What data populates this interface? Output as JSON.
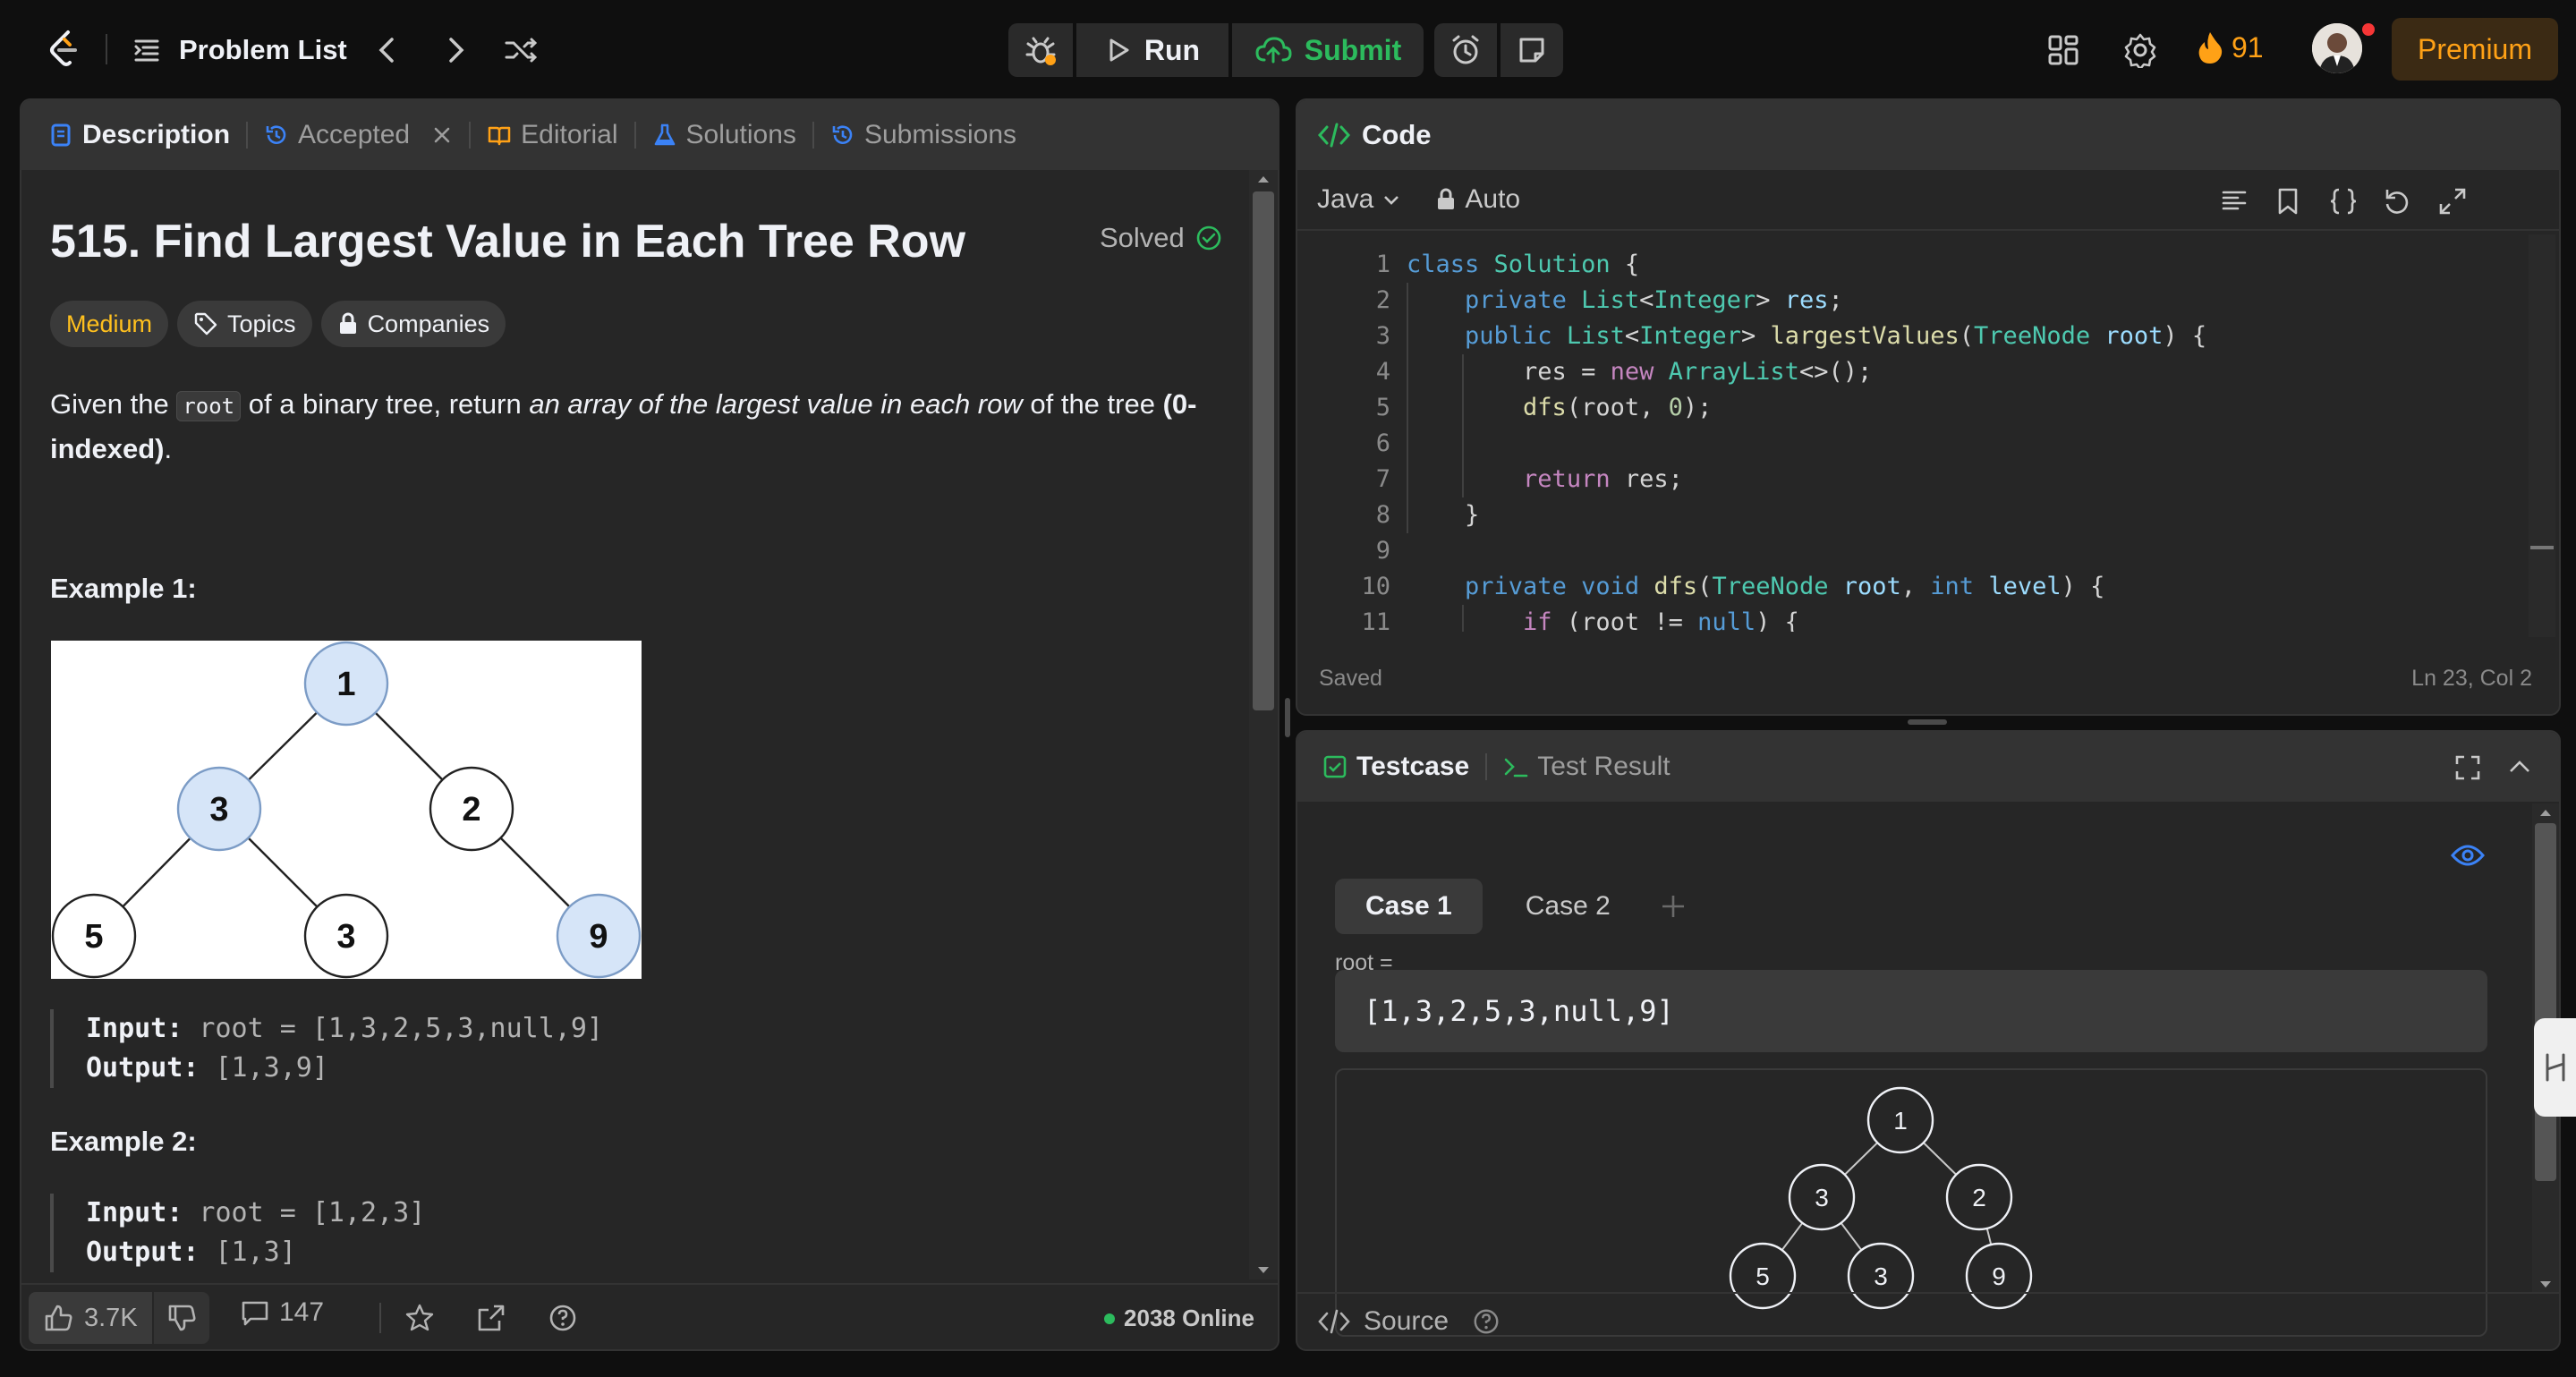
{
  "topbar": {
    "problem_list_label": "Problem List",
    "run_label": "Run",
    "submit_label": "Submit",
    "streak_count": "91",
    "premium_label": "Premium"
  },
  "left_panel": {
    "tabs": [
      {
        "label": "Description",
        "icon": "description-icon"
      },
      {
        "label": "Accepted",
        "icon": "history-icon"
      },
      {
        "label": "Editorial",
        "icon": "book-icon"
      },
      {
        "label": "Solutions",
        "icon": "flask-icon"
      },
      {
        "label": "Submissions",
        "icon": "history-icon"
      }
    ],
    "title": "515. Find Largest Value in Each Tree Row",
    "solved_label": "Solved",
    "chips": {
      "difficulty": "Medium",
      "topics": "Topics",
      "companies": "Companies"
    },
    "statement": {
      "p1": "Given the ",
      "code": "root",
      "p2": " of a binary tree, return ",
      "em": "an array of the largest value in each row",
      "p3": " of the tree ",
      "strong": "(0-indexed)",
      "p4": "."
    },
    "example1": {
      "heading": "Example 1:",
      "input_label": "Input:",
      "input_value": " root = [1,3,2,5,3,null,9]",
      "output_label": "Output:",
      "output_value": " [1,3,9]",
      "tree_nodes": [
        "1",
        "3",
        "2",
        "5",
        "3",
        "9"
      ]
    },
    "example2": {
      "heading": "Example 2:",
      "input_label": "Input:",
      "input_value": " root = [1,2,3]",
      "output_label": "Output:",
      "output_value": " [1,3]"
    },
    "footer": {
      "likes": "3.7K",
      "comments": "147",
      "online": "2038 Online"
    }
  },
  "code_panel": {
    "title": "Code",
    "language": "Java",
    "mode": "Auto",
    "line_numbers": [
      "1",
      "2",
      "3",
      "4",
      "5",
      "6",
      "7",
      "8",
      "9",
      "10",
      "11"
    ],
    "status_left": "Saved",
    "status_right": "Ln 23, Col 2"
  },
  "test_panel": {
    "tab_testcase": "Testcase",
    "tab_result": "Test Result",
    "cases": [
      "Case 1",
      "Case 2"
    ],
    "var_label": "root =",
    "input_value": "[1,3,2,5,3,null,9]",
    "tree_nodes": [
      "1",
      "3",
      "2",
      "5",
      "3",
      "9"
    ],
    "source_label": "Source"
  },
  "colors": {
    "accent_orange": "#ffa116",
    "submit_green": "#2cbb5d",
    "medium_yellow": "#ffc01e",
    "panel_bg": "#262626",
    "tab_blue": "#3b82f6"
  }
}
